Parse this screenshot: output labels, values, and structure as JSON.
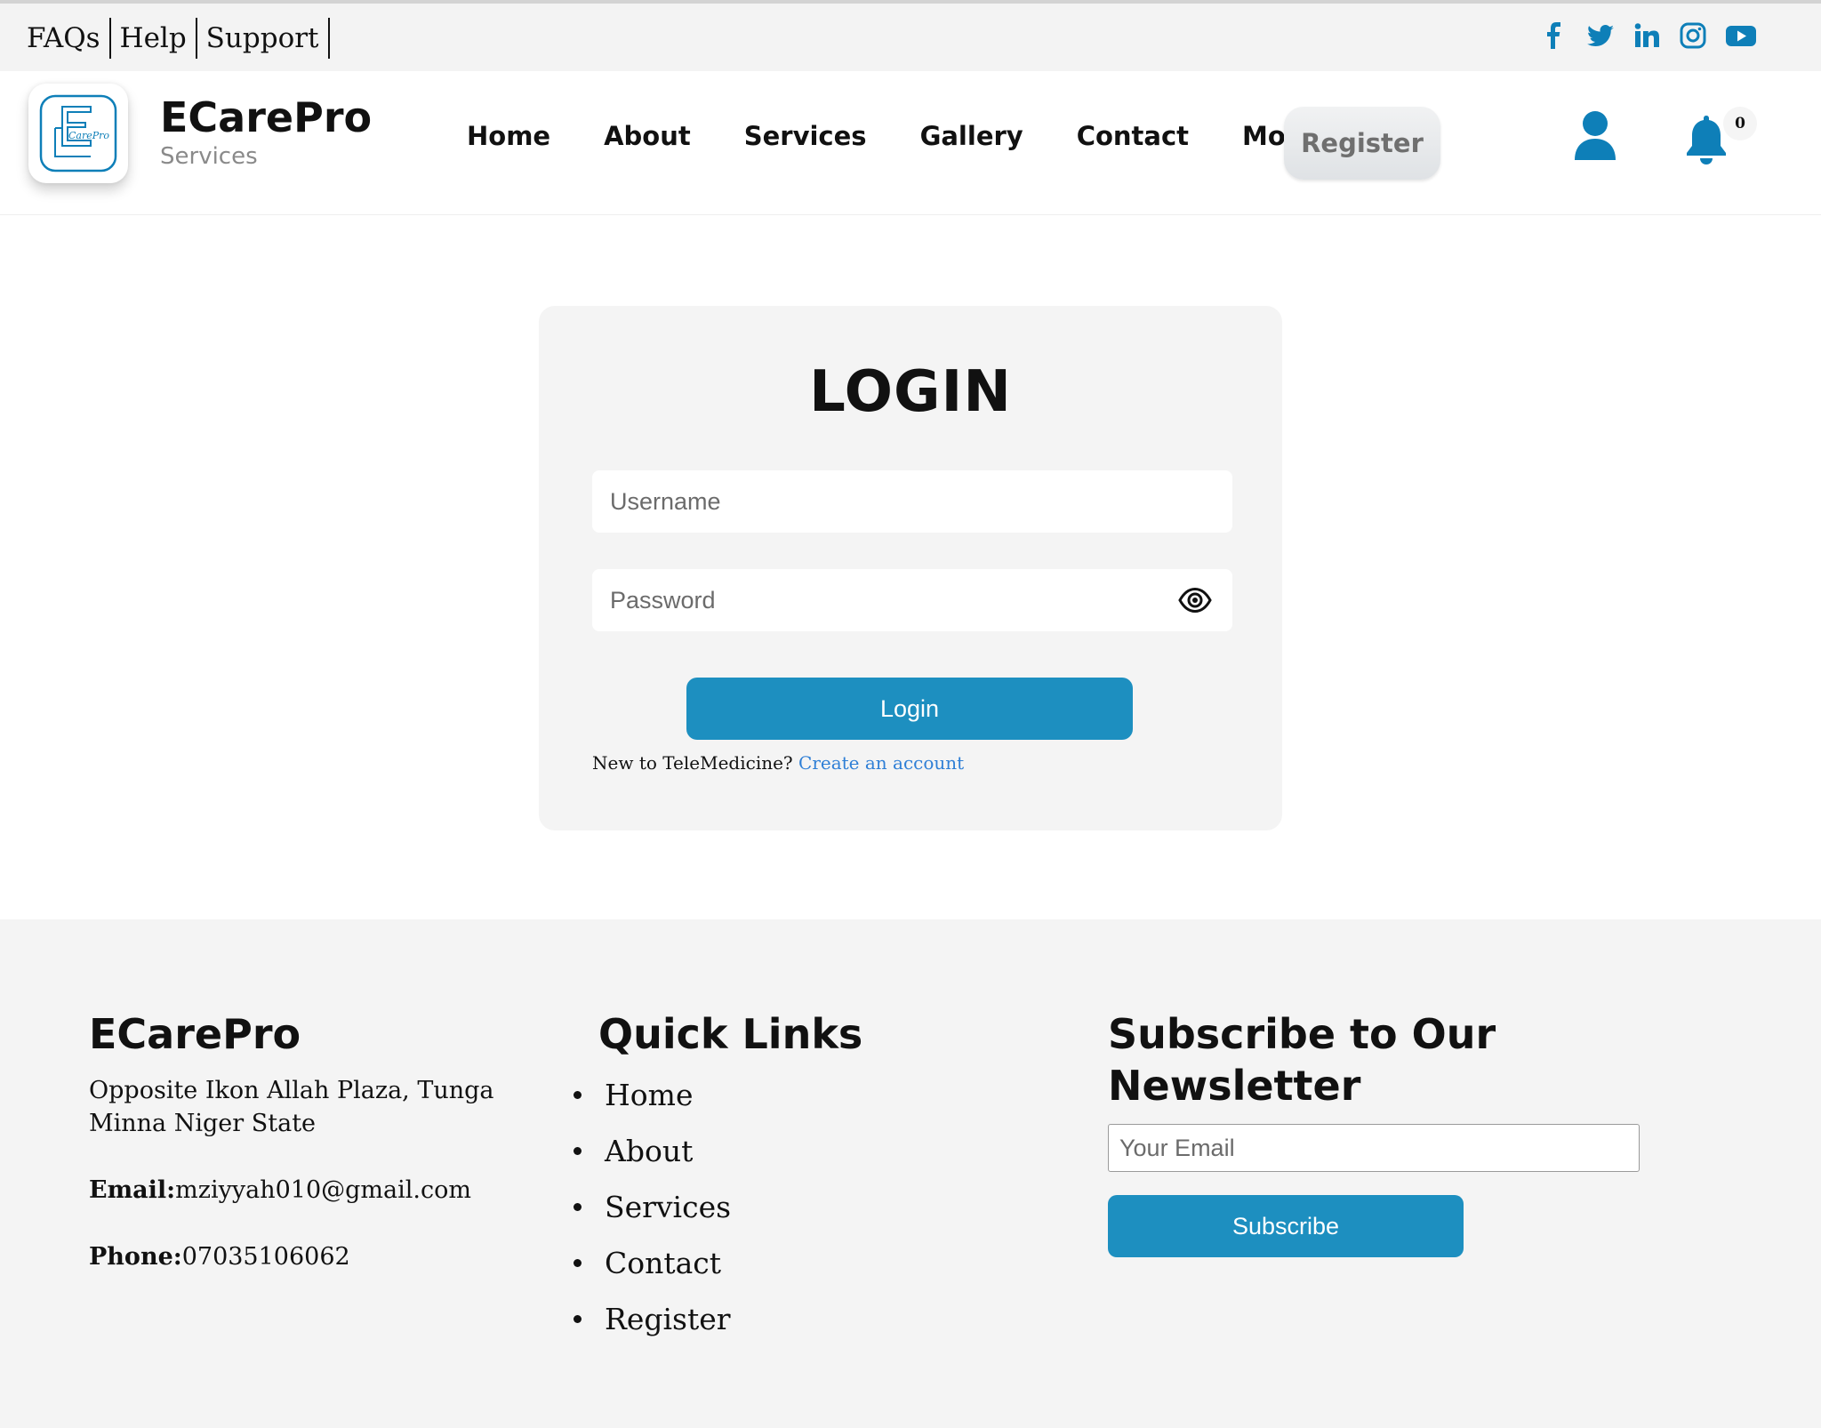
{
  "topbar": {
    "links": [
      "FAQs",
      "Help",
      "Support"
    ],
    "social_icons": [
      "facebook-icon",
      "twitter-icon",
      "linkedin-icon",
      "instagram-icon",
      "youtube-icon"
    ],
    "icon_color": "#0e7fb8"
  },
  "header": {
    "brand_name": "ECarePro",
    "brand_sub": "Services",
    "logo_text": "CarePro",
    "nav": [
      "Home",
      "About",
      "Services",
      "Gallery",
      "Contact",
      "More"
    ],
    "register_label": "Register",
    "notification_count": "0",
    "accent_color": "#0e7fb8"
  },
  "login": {
    "title": "LOGIN",
    "username_placeholder": "Username",
    "password_placeholder": "Password",
    "button_label": "Login",
    "new_user_text": "New to TeleMedicine?",
    "create_account_link": "Create an account",
    "button_color": "#1d8fc0"
  },
  "footer": {
    "about": {
      "title": "ECarePro",
      "address": "Opposite Ikon Allah Plaza, Tunga Minna Niger State",
      "email_label": "Email:",
      "email": "mziyyah010@gmail.com",
      "phone_label": "Phone:",
      "phone": "07035106062"
    },
    "quick_links": {
      "title": "Quick Links",
      "items": [
        "Home",
        "About",
        "Services",
        "Contact",
        "Register"
      ]
    },
    "newsletter": {
      "title": "Subscribe to Our Newsletter",
      "email_placeholder": "Your Email",
      "button_label": "Subscribe"
    }
  }
}
